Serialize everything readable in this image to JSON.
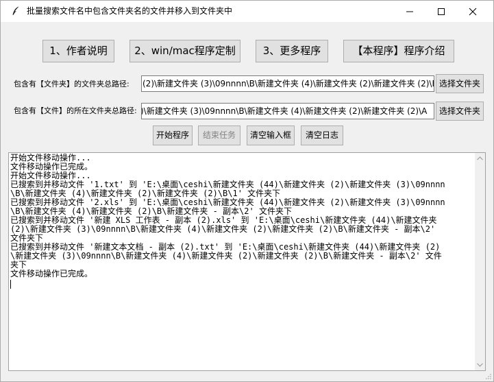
{
  "window": {
    "title": "批量搜索文件名中包含文件夹名的文件并移入到文件夹中"
  },
  "top_buttons": [
    {
      "label": "1、作者说明"
    },
    {
      "label": "2、win/mac程序定制"
    },
    {
      "label": "3、更多程序"
    },
    {
      "label": "【本程序】程序介绍"
    }
  ],
  "folder_row": {
    "label": "包含有【文件夹】的文件夹总路径:",
    "value": "(2)\\新建文件夹 (3)\\09nnnn\\B\\新建文件夹 (4)\\新建文件夹 (2)\\新建文件夹 (2)\\B",
    "button": "选择文件夹"
  },
  "file_row": {
    "label": "包含有【文件】的所在文件夹总路径:",
    "value": ")\\新建文件夹 (3)\\09nnnn\\B\\新建文件夹 (4)\\新建文件夹 (2)\\新建文件夹 (2)\\A",
    "button": "选择文件夹"
  },
  "actions": {
    "start": "开始程序",
    "stop": "结束任务",
    "clear_input": "清空输入框",
    "clear_log": "清空日志"
  },
  "log_lines": [
    "开始文件移动操作...",
    "文件移动操作已完成。",
    "开始文件移动操作...",
    "已搜索到并移动文件 '1.txt' 到 'E:\\桌面\\ceshi\\新建文件夹 (44)\\新建文件夹 (2)\\新建文件夹 (3)\\09nnnn",
    "\\B\\新建文件夹 (4)\\新建文件夹 (2)\\新建文件夹 (2)\\B\\1' 文件夹下",
    "已搜索到并移动文件 '2.xls' 到 'E:\\桌面\\ceshi\\新建文件夹 (44)\\新建文件夹 (2)\\新建文件夹 (3)\\09nnnn",
    "\\B\\新建文件夹 (4)\\新建文件夹 (2)\\B\\新建文件夹 - 副本\\2' 文件夹下",
    "已搜索到并移动文件 '新建 XLS 工作表 - 副本 (2).xls' 到 'E:\\桌面\\ceshi\\新建文件夹 (44)\\新建文件夹",
    "(2)\\新建文件夹 (3)\\09nnnn\\B\\新建文件夹 (4)\\新建文件夹 (2)\\新建文件夹 (2)\\B\\新建文件夹 - 副本\\2'",
    "文件夹下",
    "已搜索到并移动文件 '新建文本文档 - 副本 (2).txt' 到 'E:\\桌面\\ceshi\\新建文件夹 (44)\\新建文件夹 (2)",
    "\\新建文件夹 (3)\\09nnnn\\B\\新建文件夹 (4)\\新建文件夹 (2)\\新建文件夹 (2)\\B\\新建文件夹 - 副本\\2' 文件",
    "夹下",
    "文件移动操作已完成。"
  ]
}
